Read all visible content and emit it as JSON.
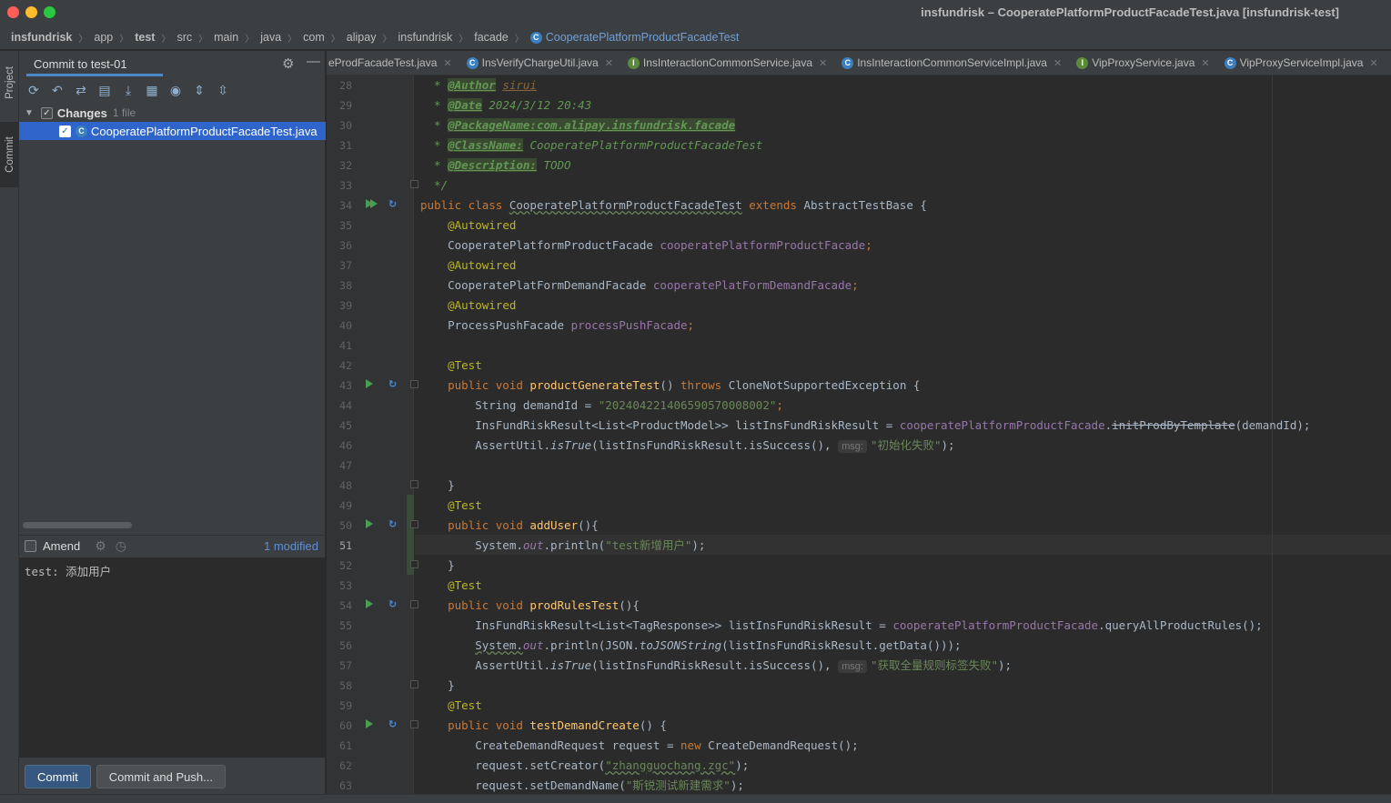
{
  "window": {
    "title": "insfundrisk – CooperatePlatformProductFacadeTest.java [insfundrisk-test]",
    "traffic_lights": {
      "close": "#ff5f57",
      "minimize": "#febc2e",
      "zoom": "#28c840"
    }
  },
  "breadcrumb": {
    "items": [
      "insfundrisk",
      "app",
      "test",
      "src",
      "main",
      "java",
      "com",
      "alipay",
      "insfundrisk",
      "facade"
    ],
    "current": "CooperatePlatformProductFacadeTest"
  },
  "left_strip": {
    "project_label": "Project",
    "commit_label": "Commit"
  },
  "commit_panel": {
    "title": "Commit to test-01",
    "changes_label": "Changes",
    "changes_count": "1 file",
    "file_name": "CooperatePlatformProductFacadeTest.java",
    "amend_label": "Amend",
    "modified_label": "1 modified",
    "message": "test: 添加用户",
    "commit_button": "Commit",
    "commit_push_button": "Commit and Push..."
  },
  "editor_tabs": [
    {
      "label": "eProdFacadeTest.java",
      "icon": "class-icon"
    },
    {
      "label": "InsVerifyChargeUtil.java",
      "icon": "class-icon"
    },
    {
      "label": "InsInteractionCommonService.java",
      "icon": "interface-icon"
    },
    {
      "label": "InsInteractionCommonServiceImpl.java",
      "icon": "class-icon"
    },
    {
      "label": "VipProxyService.java",
      "icon": "interface-icon"
    },
    {
      "label": "VipProxyServiceImpl.java",
      "icon": "class-icon"
    }
  ],
  "editor": {
    "current_line": "51",
    "lines": {
      "l28": {
        "n": "28",
        "tag": "@Author",
        "val": "sirui"
      },
      "l29": {
        "n": "29",
        "tag": "@Date",
        "val": "2024/3/12 20:43"
      },
      "l30": {
        "n": "30",
        "tag": "@PackageName:com.alipay.insfundrisk.facade"
      },
      "l31": {
        "n": "31",
        "tag": "@ClassName:",
        "val": "CooperatePlatformProductFacadeTest"
      },
      "l32": {
        "n": "32",
        "tag": "@Description:",
        "val": "TODO"
      },
      "l33": {
        "n": "33"
      },
      "l34": {
        "n": "34",
        "cls": "CooperatePlatformProductFacadeTest",
        "base": "AbstractTestBase"
      },
      "l35": {
        "n": "35",
        "ann": "@Autowired"
      },
      "l36": {
        "n": "36",
        "type": "CooperatePlatformProductFacade",
        "field": "cooperatePlatformProductFacade"
      },
      "l37": {
        "n": "37",
        "ann": "@Autowired"
      },
      "l38": {
        "n": "38",
        "type": "CooperatePlatFormDemandFacade",
        "field": "cooperatePlatFormDemandFacade"
      },
      "l39": {
        "n": "39",
        "ann": "@Autowired"
      },
      "l40": {
        "n": "40",
        "type": "ProcessPushFacade",
        "field": "processPushFacade"
      },
      "l41": {
        "n": "41"
      },
      "l42": {
        "n": "42",
        "ann": "@Test"
      },
      "l43": {
        "n": "43",
        "method": "productGenerateTest",
        "exc": "CloneNotSupportedException"
      },
      "l44": {
        "n": "44",
        "type": "String",
        "var": "demandId",
        "str": "\"202404221406590570008002\""
      },
      "l45": {
        "n": "45",
        "type": "InsFundRiskResult<List<ProductModel>>",
        "var": "listInsFundRiskResult",
        "field": "cooperatePlatformProductFacade",
        "call": "initProdByTemplate",
        "arg": "(demandId);"
      },
      "l46": {
        "n": "46",
        "cls": "AssertUtil.",
        "call": "isTrue",
        "arg": "(listInsFundRiskResult.isSuccess(), ",
        "hint": "msg:",
        "str": "\"初始化失败\""
      },
      "l47": {
        "n": "47"
      },
      "l48": {
        "n": "48"
      },
      "l49": {
        "n": "49",
        "ann": "@Test"
      },
      "l50": {
        "n": "50",
        "method": "addUser"
      },
      "l51": {
        "n": "51",
        "str": "\"test新增用户\""
      },
      "l52": {
        "n": "52"
      },
      "l53": {
        "n": "53",
        "ann": "@Test"
      },
      "l54": {
        "n": "54",
        "method": "prodRulesTest"
      },
      "l55": {
        "n": "55",
        "type": "InsFundRiskResult<List<TagResponse>>",
        "var": "listInsFundRiskResult",
        "field": "cooperatePlatformProductFacade",
        "call": ".queryAllProductRules();"
      },
      "l56": {
        "n": "56",
        "call": "toJSONString",
        "arg": "(listInsFundRiskResult.getData()));"
      },
      "l57": {
        "n": "57",
        "cls": "AssertUtil.",
        "call": "isTrue",
        "arg": "(listInsFundRiskResult.isSuccess(), ",
        "hint": "msg:",
        "str": "\"获取全量规则标签失败\""
      },
      "l58": {
        "n": "58"
      },
      "l59": {
        "n": "59",
        "ann": "@Test"
      },
      "l60": {
        "n": "60",
        "method": "testDemandCreate"
      },
      "l61": {
        "n": "61",
        "type": "CreateDemandRequest",
        "var": "request",
        "ctor": "CreateDemandRequest();"
      },
      "l62": {
        "n": "62",
        "str": "\"zhangguochang.zgc\""
      },
      "l63": {
        "n": "63",
        "str": "\"斯锐测试新建需求\""
      }
    }
  },
  "colors": {
    "keyword": "#cc7832",
    "annotation": "#bbb529",
    "field": "#9876aa",
    "string": "#6a8759",
    "method": "#ffc66d",
    "doc": "#629755",
    "selection": "#2f65ca",
    "primary_button": "#365880"
  }
}
